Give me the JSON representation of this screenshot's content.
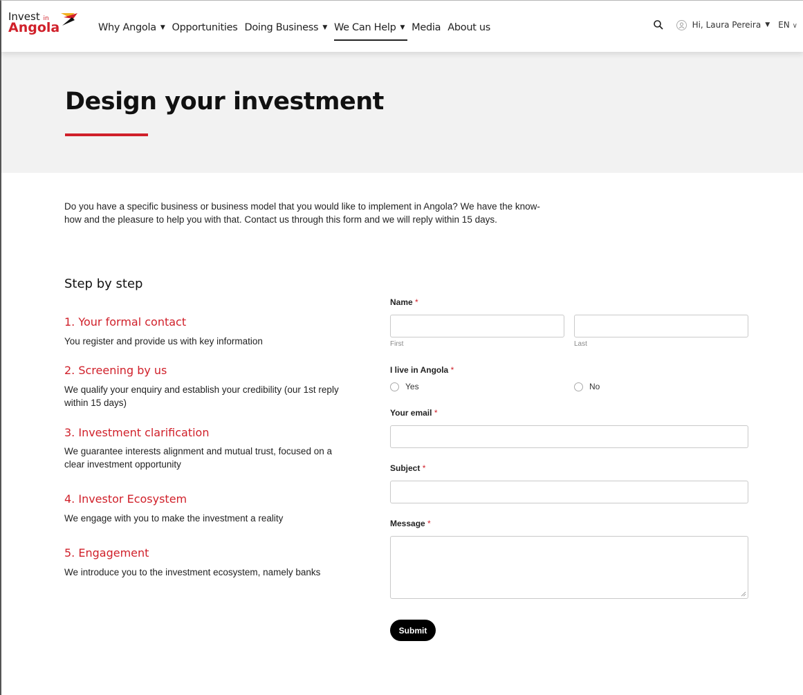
{
  "header": {
    "logo": {
      "line1": "Invest",
      "line1_small": "in",
      "line2": "Angola"
    },
    "nav": [
      {
        "label": "Why Angola",
        "has_dropdown": true
      },
      {
        "label": "Opportunities",
        "has_dropdown": false
      },
      {
        "label": "Doing Business",
        "has_dropdown": true
      },
      {
        "label": "We Can Help",
        "has_dropdown": true,
        "active": true
      },
      {
        "label": "Media",
        "has_dropdown": false
      },
      {
        "label": "About us",
        "has_dropdown": false
      }
    ],
    "user_greeting": "Hi, Laura Pereira",
    "language": "EN",
    "icons": [
      "search-icon",
      "user-icon"
    ]
  },
  "hero": {
    "title": "Design your investment"
  },
  "intro": "Do you have a specific business or business model that you would like to implement in Angola? We have the know-how and the pleasure to help you with that. Contact us through this form and we will reply within 15 days.",
  "steps": {
    "heading": "Step by step",
    "items": [
      {
        "title": "1. Your formal contact",
        "desc": "You register and provide us with key information"
      },
      {
        "title": "2. Screening by us",
        "desc": "We qualify your enquiry and establish your credibility (our 1st reply within 15 days)"
      },
      {
        "title": "3. Investment clarification",
        "desc": "We guarantee interests alignment and mutual trust, focused on a clear investment opportunity"
      },
      {
        "title": "4. Investor Ecosystem",
        "desc": "We engage with you to make the investment a reality"
      },
      {
        "title": "5. Engagement",
        "desc": "We introduce you to the investment ecosystem, namely banks"
      }
    ]
  },
  "form": {
    "name_label": "Name",
    "first_sublabel": "First",
    "last_sublabel": "Last",
    "live_label": "I live in Angola",
    "yes_label": "Yes",
    "no_label": "No",
    "email_label": "Your email",
    "subject_label": "Subject",
    "message_label": "Message",
    "required_mark": "*",
    "submit_label": "Submit"
  },
  "colors": {
    "accent": "#d0202a",
    "hero_bg": "#f2f2f2",
    "button": "#000000"
  }
}
